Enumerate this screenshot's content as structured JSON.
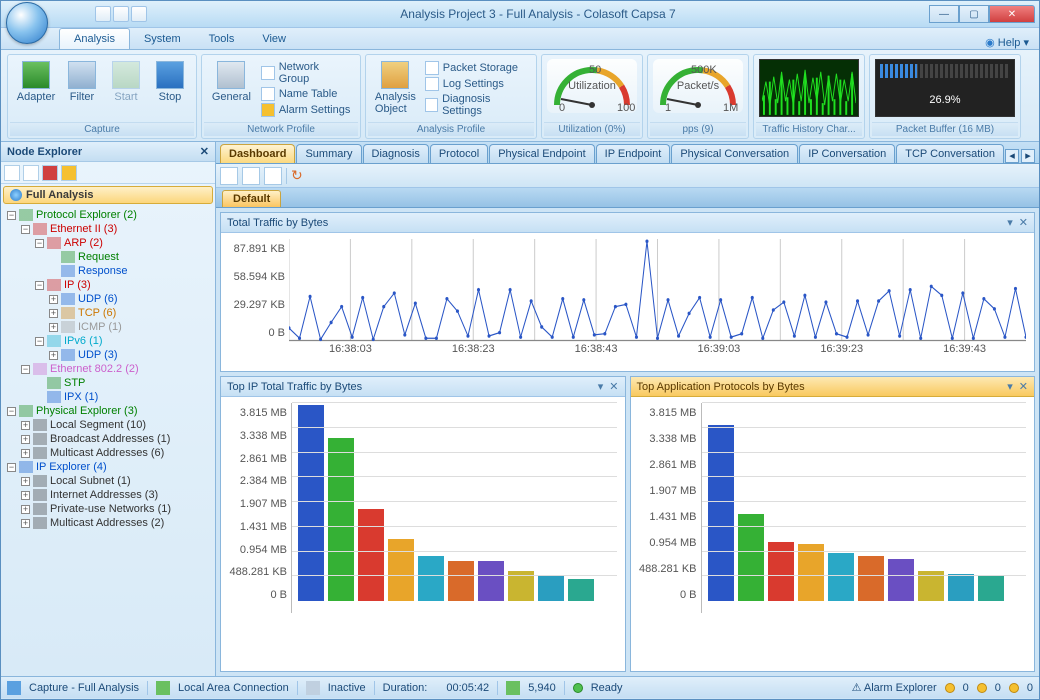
{
  "title": "Analysis Project 3 - Full Analysis - Colasoft Capsa 7",
  "menus": {
    "analysis": "Analysis",
    "system": "System",
    "tools": "Tools",
    "view": "View",
    "help": "Help"
  },
  "ribbon": {
    "capture": {
      "label": "Capture",
      "adapter": "Adapter",
      "filter": "Filter",
      "start": "Start",
      "stop": "Stop"
    },
    "netprofile": {
      "label": "Network Profile",
      "general": "General",
      "ngroup": "Network Group",
      "ntable": "Name Table",
      "alarm": "Alarm Settings"
    },
    "aprofile": {
      "label": "Analysis Profile",
      "aobject": "Analysis\nObject",
      "pktstore": "Packet Storage",
      "logset": "Log Settings",
      "diagset": "Diagnosis Settings"
    },
    "util": {
      "label": "Utilization (0%)",
      "gauge_label": "Utilization"
    },
    "pps": {
      "label": "pps (9)",
      "gauge_label": "Packet/s"
    },
    "thist": {
      "label": "Traffic History Char..."
    },
    "pbuf": {
      "label": "Packet Buffer (16 MB)",
      "pct": "26.9%"
    }
  },
  "sidebar": {
    "title": "Node Explorer",
    "root": "Full Analysis"
  },
  "tree": [
    {
      "d": 0,
      "t": "⊟",
      "c": "#008000",
      "l": "Protocol Explorer (2)"
    },
    {
      "d": 1,
      "t": "⊟",
      "c": "#cc0000",
      "l": "Ethernet II (3)"
    },
    {
      "d": 2,
      "t": "⊟",
      "c": "#cc0000",
      "l": "ARP (2)"
    },
    {
      "d": 3,
      "t": "",
      "c": "#008000",
      "l": "Request"
    },
    {
      "d": 3,
      "t": "",
      "c": "#0050cc",
      "l": "Response"
    },
    {
      "d": 2,
      "t": "⊟",
      "c": "#cc0000",
      "l": "IP (3)"
    },
    {
      "d": 3,
      "t": "⊞",
      "c": "#0050cc",
      "l": "UDP (6)"
    },
    {
      "d": 3,
      "t": "⊞",
      "c": "#cc7700",
      "l": "TCP (6)"
    },
    {
      "d": 3,
      "t": "⊞",
      "c": "#999",
      "l": "ICMP (1)"
    },
    {
      "d": 2,
      "t": "⊟",
      "c": "#00aacc",
      "l": "IPv6 (1)"
    },
    {
      "d": 3,
      "t": "⊞",
      "c": "#0050cc",
      "l": "UDP (3)"
    },
    {
      "d": 1,
      "t": "⊟",
      "c": "#cc60cc",
      "l": "Ethernet 802.2 (2)"
    },
    {
      "d": 2,
      "t": "",
      "c": "#008000",
      "l": "STP"
    },
    {
      "d": 2,
      "t": "",
      "c": "#0050cc",
      "l": "IPX (1)"
    },
    {
      "d": 0,
      "t": "⊟",
      "c": "#008000",
      "l": "Physical Explorer (3)"
    },
    {
      "d": 1,
      "t": "⊞",
      "c": "#333",
      "l": "Local Segment (10)"
    },
    {
      "d": 1,
      "t": "⊞",
      "c": "#333",
      "l": "Broadcast Addresses (1)"
    },
    {
      "d": 1,
      "t": "⊞",
      "c": "#333",
      "l": "Multicast Addresses (6)"
    },
    {
      "d": 0,
      "t": "⊟",
      "c": "#0050cc",
      "l": "IP Explorer (4)"
    },
    {
      "d": 1,
      "t": "⊞",
      "c": "#333",
      "l": "Local Subnet (1)"
    },
    {
      "d": 1,
      "t": "⊞",
      "c": "#333",
      "l": "Internet Addresses (3)"
    },
    {
      "d": 1,
      "t": "⊞",
      "c": "#333",
      "l": "Private-use Networks (1)"
    },
    {
      "d": 1,
      "t": "⊞",
      "c": "#333",
      "l": "Multicast Addresses (2)"
    }
  ],
  "viewtabs": [
    "Dashboard",
    "Summary",
    "Diagnosis",
    "Protocol",
    "Physical Endpoint",
    "IP Endpoint",
    "Physical Conversation",
    "IP Conversation",
    "TCP Conversation"
  ],
  "dashboard_tab": "Default",
  "panel_traffic": {
    "title": "Total Traffic by Bytes"
  },
  "panel_ip": {
    "title": "Top IP Total Traffic by Bytes"
  },
  "panel_proto": {
    "title": "Top Application Protocols by Bytes"
  },
  "chart_data": [
    {
      "id": "traffic",
      "type": "line",
      "title": "Total Traffic by Bytes",
      "y_ticks": [
        "87.891 KB",
        "58.594 KB",
        "29.297 KB",
        "0  B"
      ],
      "x_ticks": [
        "16:38:03",
        "16:38:23",
        "16:38:43",
        "16:39:03",
        "16:39:23",
        "16:39:43"
      ],
      "ylim_kb": [
        0,
        90
      ],
      "values_kb": [
        11,
        2,
        39,
        1,
        16,
        30,
        3,
        38,
        1,
        30,
        42,
        5,
        33,
        2,
        2,
        37,
        26,
        4,
        45,
        4,
        7,
        45,
        3,
        35,
        12,
        3,
        37,
        3,
        36,
        5,
        6,
        30,
        32,
        3,
        88,
        2,
        36,
        4,
        24,
        38,
        3,
        36,
        3,
        6,
        38,
        2,
        27,
        34,
        4,
        40,
        3,
        34,
        6,
        3,
        35,
        5,
        35,
        44,
        4,
        45,
        2,
        48,
        40,
        2,
        42,
        2,
        37,
        28,
        3,
        46,
        3
      ]
    },
    {
      "id": "top_ip",
      "type": "bar",
      "title": "Top IP Total Traffic by Bytes",
      "y_ticks": [
        "3.815 MB",
        "3.338 MB",
        "2.861 MB",
        "2.384 MB",
        "1.907 MB",
        "1.431 MB",
        "0.954 MB",
        "488.281 KB",
        "0  B"
      ],
      "ylim_mb": [
        0,
        4.0
      ],
      "series": [
        {
          "values_mb": [
            3.95,
            3.3,
            1.85,
            1.25,
            0.9,
            0.8,
            0.8,
            0.6,
            0.5,
            0.45
          ],
          "colors": [
            "#2a56c6",
            "#35b135",
            "#d93a2f",
            "#e8a52a",
            "#2aa8c6",
            "#d96a2a",
            "#6a4fc2",
            "#c9b530",
            "#2a9ec0",
            "#2aa890"
          ]
        }
      ]
    },
    {
      "id": "top_proto",
      "type": "bar",
      "title": "Top Application Protocols by Bytes",
      "y_ticks": [
        "3.815 MB",
        "3.338 MB",
        "2.861 MB",
        "1.907 MB",
        "1.431 MB",
        "0.954 MB",
        "488.281 KB",
        "0  B"
      ],
      "ylim_mb": [
        0,
        4.0
      ],
      "series": [
        {
          "values_mb": [
            3.55,
            1.75,
            1.2,
            1.15,
            0.98,
            0.9,
            0.85,
            0.6,
            0.55,
            0.5
          ],
          "colors": [
            "#2a56c6",
            "#35b135",
            "#d93a2f",
            "#e8a52a",
            "#2aa8c6",
            "#d96a2a",
            "#6a4fc2",
            "#c9b530",
            "#2a9ec0",
            "#2aa890"
          ]
        }
      ]
    }
  ],
  "status": {
    "capture": "Capture - Full Analysis",
    "conn": "Local Area Connection",
    "state": "Inactive",
    "duration_label": "Duration:",
    "duration": "00:05:42",
    "count": "5,940",
    "ready": "Ready",
    "alarm": "Alarm Explorer",
    "a0": "0",
    "a1": "0",
    "a2": "0"
  }
}
